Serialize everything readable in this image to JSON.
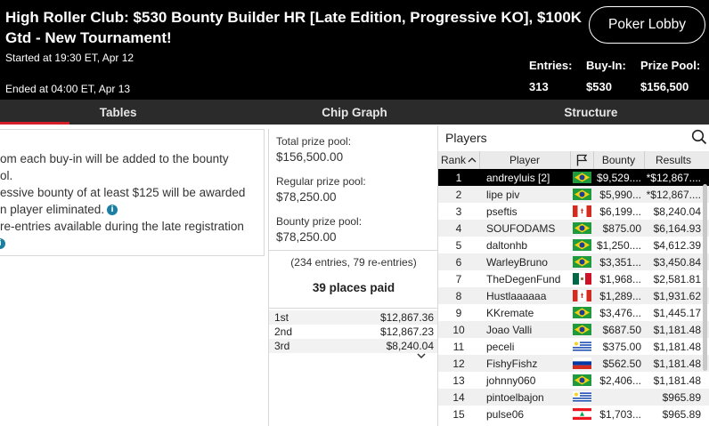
{
  "header": {
    "title": "High Roller Club: $530 Bounty Builder HR [Late Edition, Progressive KO], $100K Gtd - New Tournament!",
    "started": "Started at 19:30 ET, Apr 12",
    "ended": "Ended at 04:00 ET, Apr 13",
    "lobby_button": "Poker Lobby",
    "stats": {
      "entries_label": "Entries:",
      "entries_value": "313",
      "buyin_label": "Buy-In:",
      "buyin_value": "$530",
      "prize_label": "Prize Pool:",
      "prize_value": "$156,500"
    }
  },
  "tabs": [
    {
      "label": "Tables",
      "active": true
    },
    {
      "label": "Chip Graph",
      "active": false
    },
    {
      "label": "Structure",
      "active": false
    }
  ],
  "info": {
    "line1": "om each buy-in will be added to the bounty",
    "line2": "ol.",
    "line3": "essive bounty of at least $125 will be awarded",
    "line4": "n player eliminated.",
    "line5": "re-entries available during the late registration",
    "info_icon": "info-icon"
  },
  "prize_panel": {
    "total_label": "Total prize pool:",
    "total_value": "$156,500.00",
    "regular_label": "Regular prize pool:",
    "regular_value": "$78,250.00",
    "bounty_label": "Bounty prize pool:",
    "bounty_value": "$78,250.00",
    "entries_text": "(234 entries, 79 re-entries)",
    "places_paid": "39 places paid",
    "payouts": [
      {
        "place": "1st",
        "amount": "$12,867.36"
      },
      {
        "place": "2nd",
        "amount": "$12,867.23"
      },
      {
        "place": "3rd",
        "amount": "$8,240.04"
      }
    ]
  },
  "players": {
    "title": "Players",
    "columns": {
      "rank": "Rank",
      "player": "Player",
      "bounty": "Bounty",
      "results": "Results"
    },
    "rows": [
      {
        "rank": "1",
        "player": "andreyluis [2]",
        "flag": "brazil",
        "bounty": "$9,529....",
        "results": "*$12,867....",
        "selected": true
      },
      {
        "rank": "2",
        "player": "lipe piv",
        "flag": "brazil",
        "bounty": "$5,990...",
        "results": "*$12,867...."
      },
      {
        "rank": "3",
        "player": "pseftis",
        "flag": "canada",
        "bounty": "$6,199...",
        "results": "$8,240.04"
      },
      {
        "rank": "4",
        "player": "SOUFODAMS",
        "flag": "brazil",
        "bounty": "$875.00",
        "results": "$6,164.93"
      },
      {
        "rank": "5",
        "player": "daltonhb",
        "flag": "brazil",
        "bounty": "$1,250....",
        "results": "$4,612.39"
      },
      {
        "rank": "6",
        "player": "WarleyBruno",
        "flag": "brazil",
        "bounty": "$3,351...",
        "results": "$3,450.84"
      },
      {
        "rank": "7",
        "player": "TheDegenFund",
        "flag": "mexico",
        "bounty": "$1,968...",
        "results": "$2,581.81"
      },
      {
        "rank": "8",
        "player": "Hustlaaaaaa",
        "flag": "canada",
        "bounty": "$1,289...",
        "results": "$1,931.62"
      },
      {
        "rank": "9",
        "player": "KKremate",
        "flag": "brazil",
        "bounty": "$3,476...",
        "results": "$1,445.17"
      },
      {
        "rank": "10",
        "player": "Joao Valli",
        "flag": "brazil",
        "bounty": "$687.50",
        "results": "$1,181.48"
      },
      {
        "rank": "11",
        "player": "peceli",
        "flag": "uruguay",
        "bounty": "$375.00",
        "results": "$1,181.48"
      },
      {
        "rank": "12",
        "player": "FishyFishz",
        "flag": "russia",
        "bounty": "$562.50",
        "results": "$1,181.48"
      },
      {
        "rank": "13",
        "player": "johnny060",
        "flag": "brazil",
        "bounty": "$2,406...",
        "results": "$1,181.48"
      },
      {
        "rank": "14",
        "player": "pintoelbajon",
        "flag": "uruguay",
        "bounty": "",
        "results": "$965.89"
      },
      {
        "rank": "15",
        "player": "pulse06",
        "flag": "lebanon",
        "bounty": "$1,703...",
        "results": "$965.89"
      }
    ]
  }
}
